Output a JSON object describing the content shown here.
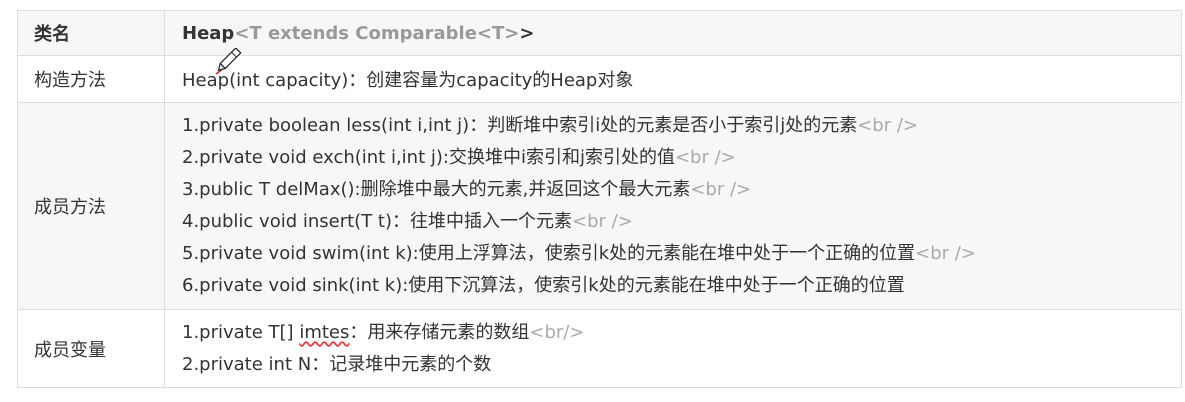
{
  "table": {
    "header": {
      "key": "类名",
      "class_name": "Heap",
      "generic": "<T extends Comparable<T>",
      "close": ">"
    },
    "constructor": {
      "key": "构造方法",
      "text": "Heap(int capacity)：创建容量为capacity的Heap对象"
    },
    "methods": {
      "key": "成员方法",
      "lines": [
        {
          "text": "1.private boolean less(int i,int j)：判断堆中索引i处的元素是否小于索引j处的元素",
          "tag": "<br />"
        },
        {
          "text": "2.private void exch(int i,int j):交换堆中i索引和j索引处的值",
          "tag": "<br />"
        },
        {
          "text": "3.public T delMax():删除堆中最大的元素,并返回这个最大元素",
          "tag": "<br />"
        },
        {
          "text": "4.public void insert(T t)：往堆中插入一个元素",
          "tag": "<br />"
        },
        {
          "text": "5.private void swim(int k):使用上浮算法，使索引k处的元素能在堆中处于一个正确的位置",
          "tag": "<br />"
        },
        {
          "text": "6.private void sink(int k):使用下沉算法，使索引k处的元素能在堆中处于一个正确的位置",
          "tag": ""
        }
      ]
    },
    "fields": {
      "key": "成员变量",
      "line1_prefix": "1.private T[] ",
      "line1_word": "imtes",
      "line1_suffix": "：用来存储元素的数组",
      "line1_tag": "<br/>",
      "line2": "2.private int N：记录堆中元素的个数"
    }
  },
  "cursor_icon": "pen-cursor-icon"
}
